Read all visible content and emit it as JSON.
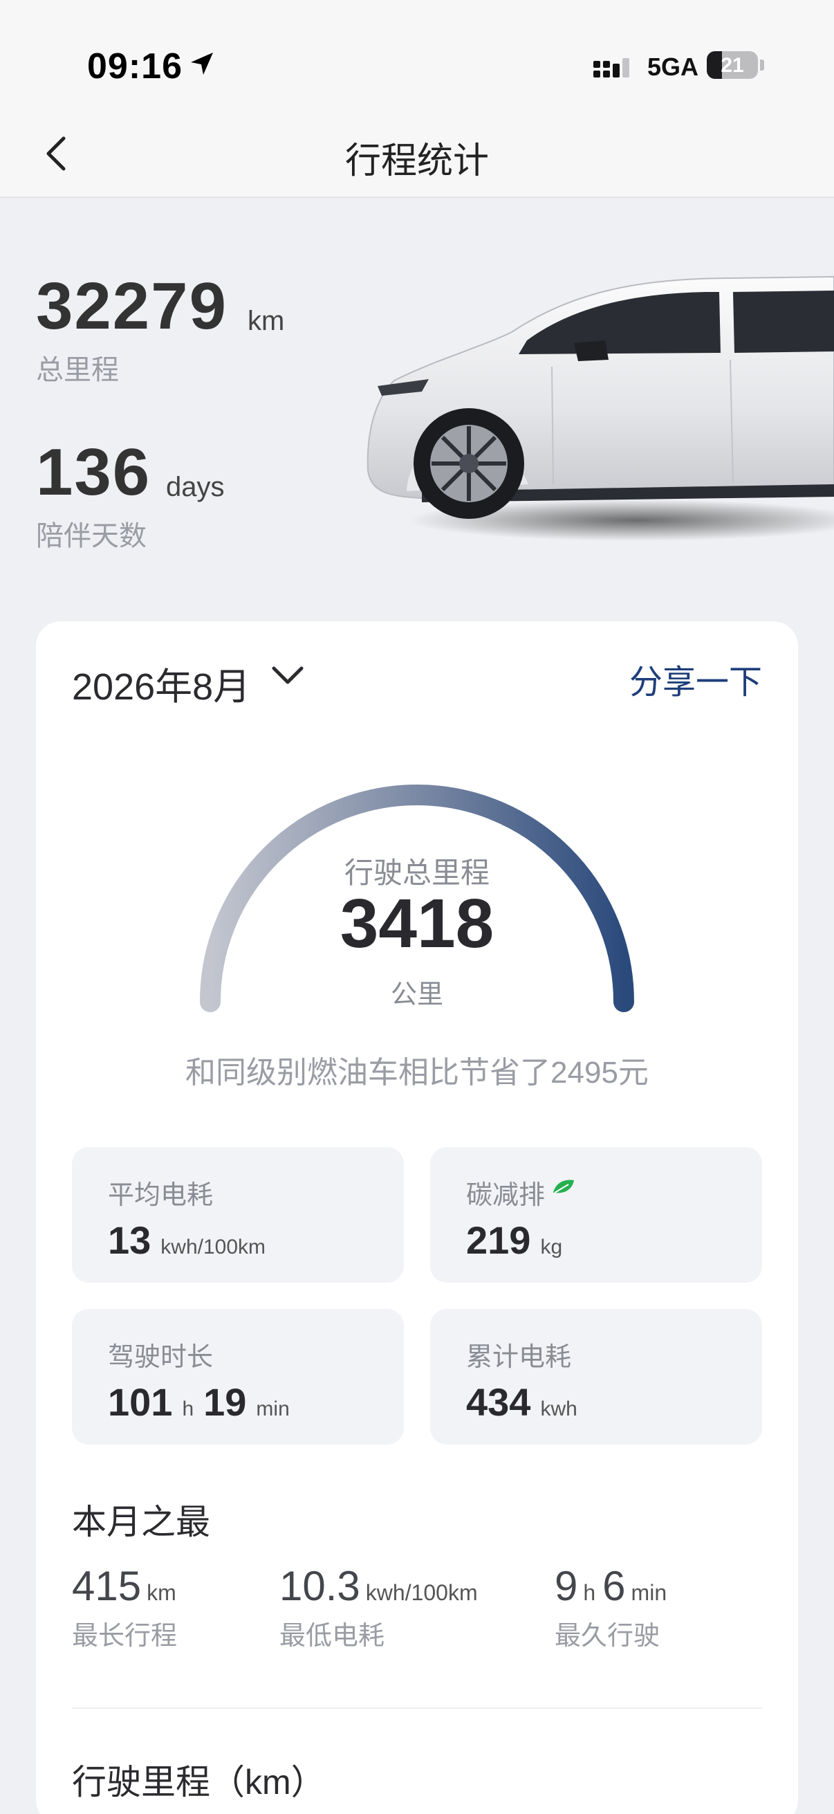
{
  "status_bar": {
    "time": "09:16",
    "network": "5GA",
    "battery": "21"
  },
  "nav": {
    "title": "行程统计"
  },
  "hero": {
    "total_mileage": "32279",
    "total_mileage_unit": "km",
    "total_mileage_label": "总里程",
    "days": "136",
    "days_unit": "days",
    "days_label": "陪伴天数"
  },
  "card": {
    "month": "2026年8月",
    "share": "分享一下",
    "gauge": {
      "label": "行驶总里程",
      "value": "3418",
      "unit": "公里",
      "fill_fraction": 1.0
    },
    "saving_text": "和同级别燃油车相比节省了2495元",
    "stats": {
      "avg_consumption": {
        "label": "平均电耗",
        "value": "13",
        "unit": "kwh/100km"
      },
      "carbon": {
        "label": "碳减排",
        "value": "219",
        "unit": "kg"
      },
      "duration": {
        "label": "驾驶时长",
        "hours": "101",
        "h_unit": "h",
        "minutes": "19",
        "min_unit": "min"
      },
      "total_energy": {
        "label": "累计电耗",
        "value": "434",
        "unit": "kwh"
      }
    },
    "best": {
      "title": "本月之最",
      "longest": {
        "value": "415",
        "unit": "km",
        "label": "最长行程"
      },
      "lowest": {
        "value": "10.3",
        "unit": "kwh/100km",
        "label": "最低电耗"
      },
      "longest_time": {
        "hours": "9",
        "h_unit": "h",
        "minutes": "6",
        "min_unit": "min",
        "label": "最久行驶"
      }
    },
    "trip_title": "行驶里程（km）"
  },
  "colors": {
    "accent": "#1d3e7a",
    "gauge_start": "#a9aebb",
    "gauge_end": "#2b4a7c",
    "leaf": "#27b04f"
  }
}
